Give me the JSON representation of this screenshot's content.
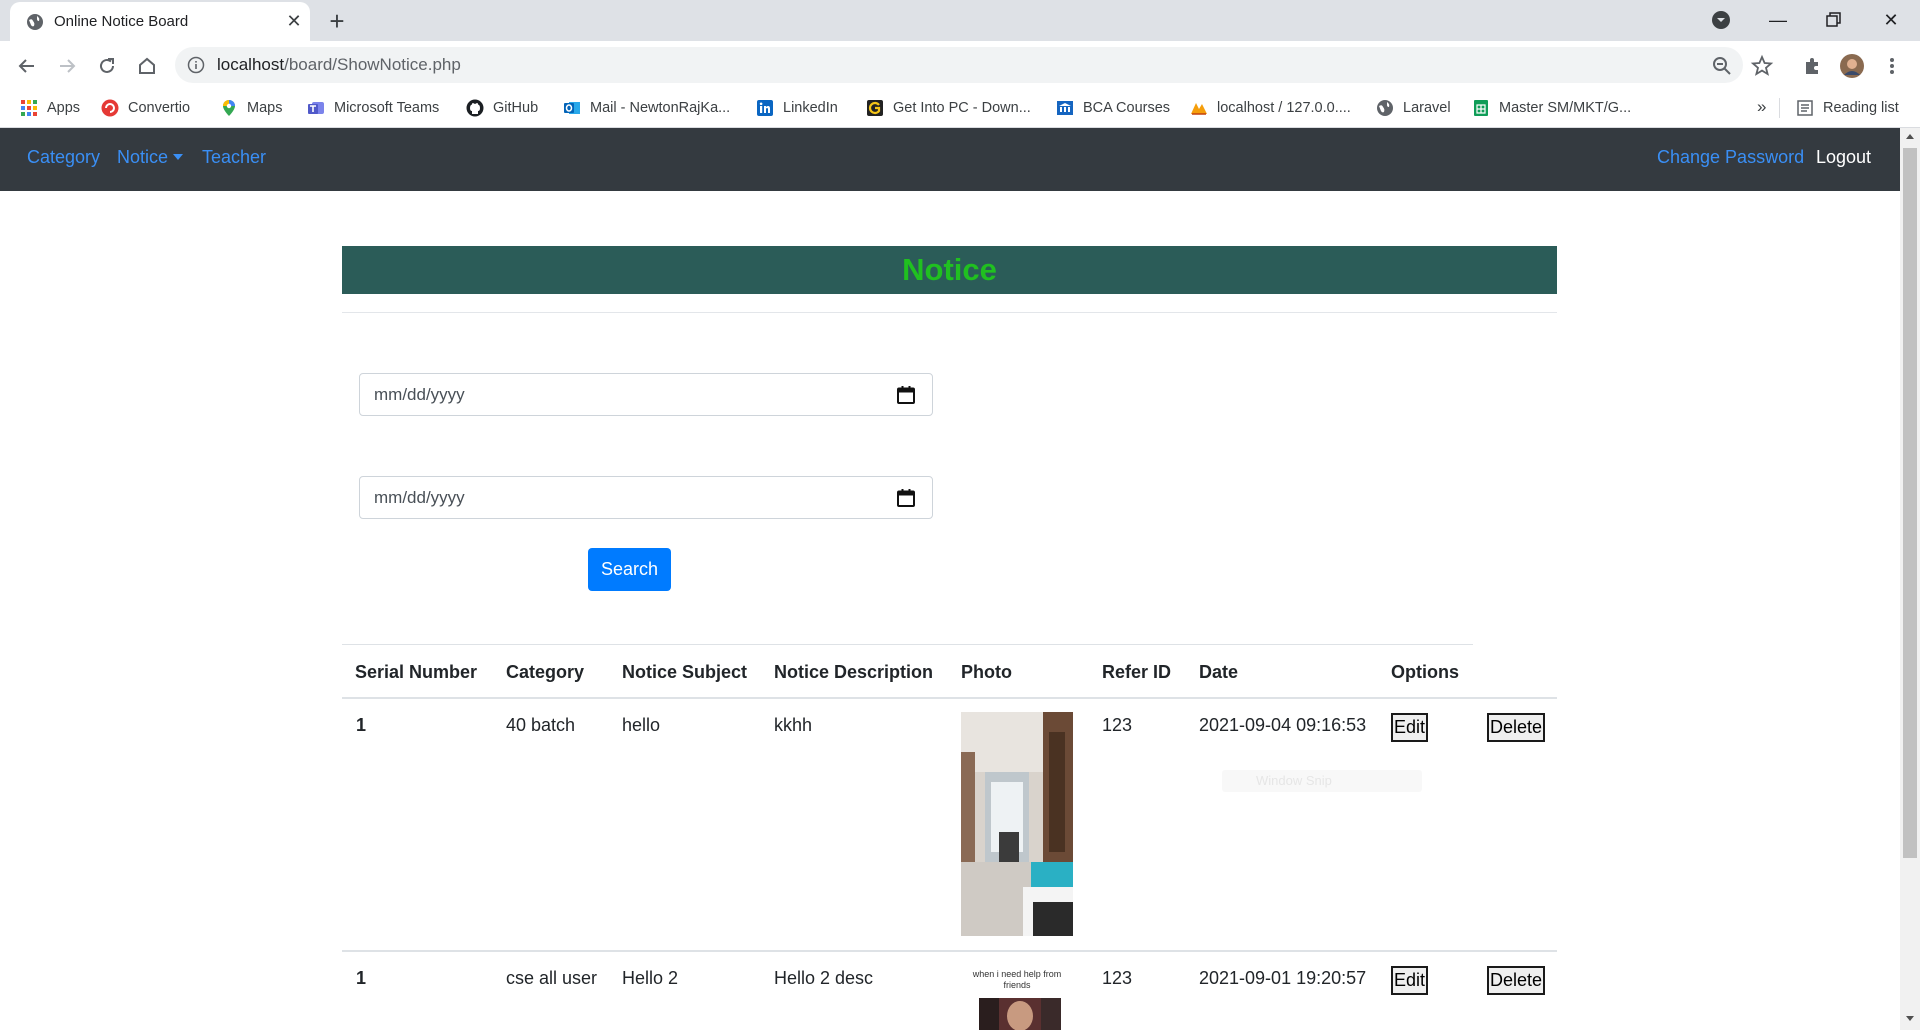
{
  "browser": {
    "tab_title": "Online Notice Board",
    "url_host": "localhost",
    "url_path": "/board/ShowNotice.php",
    "bookmarks": [
      {
        "label": "Apps",
        "icon": "apps-grid-icon"
      },
      {
        "label": "Convertio",
        "icon": "convertio-icon"
      },
      {
        "label": "Maps",
        "icon": "maps-pin-icon"
      },
      {
        "label": "Microsoft Teams",
        "icon": "teams-icon"
      },
      {
        "label": "GitHub",
        "icon": "github-icon"
      },
      {
        "label": "Mail - NewtonRajKa...",
        "icon": "outlook-icon"
      },
      {
        "label": "LinkedIn",
        "icon": "linkedin-icon"
      },
      {
        "label": "Get Into PC - Down...",
        "icon": "getintopc-icon"
      },
      {
        "label": "BCA Courses",
        "icon": "bca-icon"
      },
      {
        "label": "localhost / 127.0.0....",
        "icon": "phpmyadmin-icon"
      },
      {
        "label": "Laravel",
        "icon": "globe-icon"
      },
      {
        "label": "Master SM/MKT/G...",
        "icon": "sheets-icon"
      }
    ],
    "more_bookmarks": "»",
    "reading_list": "Reading list"
  },
  "nav": {
    "category": "Category",
    "notice": "Notice",
    "teacher": "Teacher",
    "change_password": "Change Password",
    "logout": "Logout"
  },
  "page": {
    "title": "Notice",
    "date_from_placeholder": "mm/dd/yyyy",
    "date_to_placeholder": "mm/dd/yyyy",
    "search_label": "Search"
  },
  "table": {
    "headers": [
      "Serial Number",
      "Category",
      "Notice Subject",
      "Notice Description",
      "Photo",
      "Refer ID",
      "Date",
      "Options"
    ],
    "rows": [
      {
        "serial": "1",
        "category": "40 batch",
        "subject": "hello",
        "description": "kkhh",
        "refer_id": "123",
        "date": "2021-09-04 09:16:53",
        "edit": "Edit",
        "delete": "Delete"
      },
      {
        "serial": "1",
        "category": "cse all user",
        "subject": "Hello 2",
        "description": "Hello 2 desc",
        "refer_id": "123",
        "date": "2021-09-01 19:20:57",
        "edit": "Edit",
        "delete": "Delete"
      }
    ],
    "photo2_caption_line1": "when i need help from",
    "photo2_caption_line2": "friends"
  },
  "overlay": {
    "watermark": "Window Snip"
  },
  "colors": {
    "navbar_bg": "#343a40",
    "nav_link": "#3a8ff5",
    "banner_bg": "#2b5c58",
    "banner_text": "#20c020",
    "primary_button": "#007bff"
  }
}
